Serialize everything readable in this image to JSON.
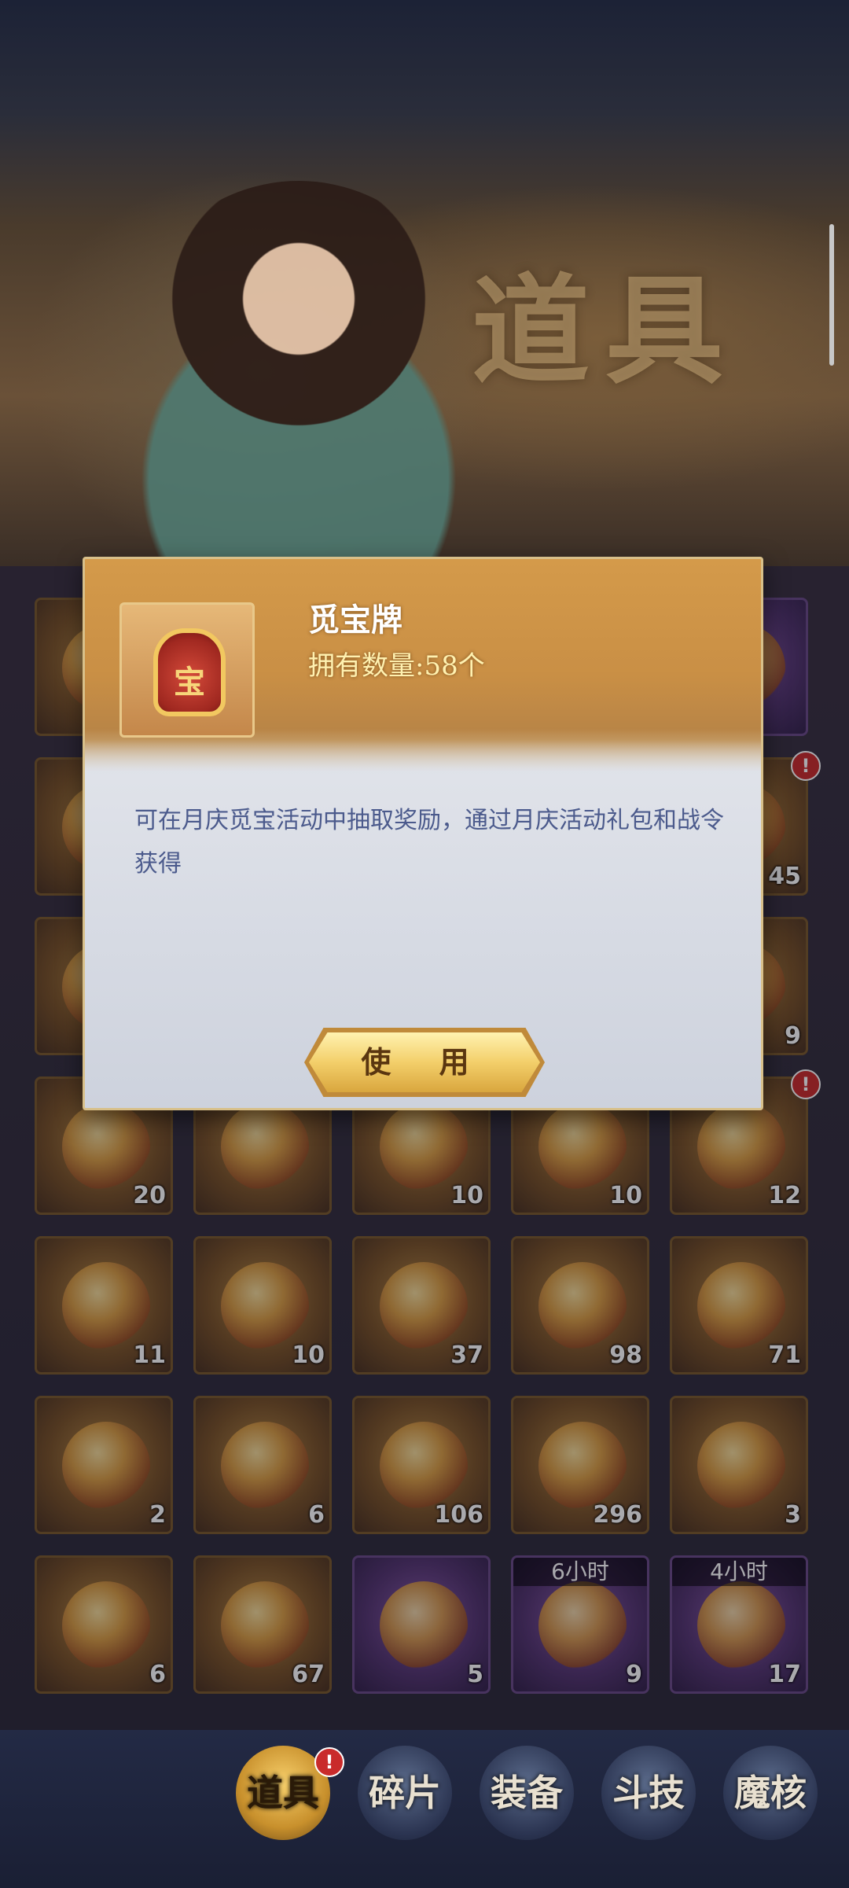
{
  "banner": {
    "title": "道具"
  },
  "popup": {
    "item_name": "觅宝牌",
    "owned": "拥有数量:58个",
    "icon_glyph": "宝",
    "description": "可在月庆觅宝活动中抽取奖励，通过月庆活动礼包和战令获得",
    "use_label": "使 用"
  },
  "items": [
    {
      "count": ""
    },
    {
      "count": ""
    },
    {
      "count": ""
    },
    {
      "count": ""
    },
    {
      "count": ""
    },
    {
      "count": ""
    },
    {
      "count": ""
    },
    {
      "count": ""
    },
    {
      "count": ""
    },
    {
      "count": "45"
    },
    {
      "count": ""
    },
    {
      "count": ""
    },
    {
      "count": ""
    },
    {
      "count": ""
    },
    {
      "count": "9"
    },
    {
      "count": "20"
    },
    {
      "count": ""
    },
    {
      "count": "10"
    },
    {
      "count": "10"
    },
    {
      "count": "12"
    },
    {
      "count": "11"
    },
    {
      "count": "10"
    },
    {
      "count": "37"
    },
    {
      "count": "98"
    },
    {
      "count": "71"
    },
    {
      "count": "2"
    },
    {
      "count": "6"
    },
    {
      "count": "106"
    },
    {
      "count": "296"
    },
    {
      "count": "3"
    },
    {
      "count": "6"
    },
    {
      "count": "67"
    },
    {
      "count": "5"
    },
    {
      "count": "9",
      "timer": "6小时"
    },
    {
      "count": "17",
      "timer": "4小时"
    }
  ],
  "alert_mark": "!",
  "tabs": [
    {
      "label": "道具",
      "active": true
    },
    {
      "label": "碎片",
      "active": false
    },
    {
      "label": "装备",
      "active": false
    },
    {
      "label": "斗技",
      "active": false
    },
    {
      "label": "魔核",
      "active": false
    }
  ]
}
